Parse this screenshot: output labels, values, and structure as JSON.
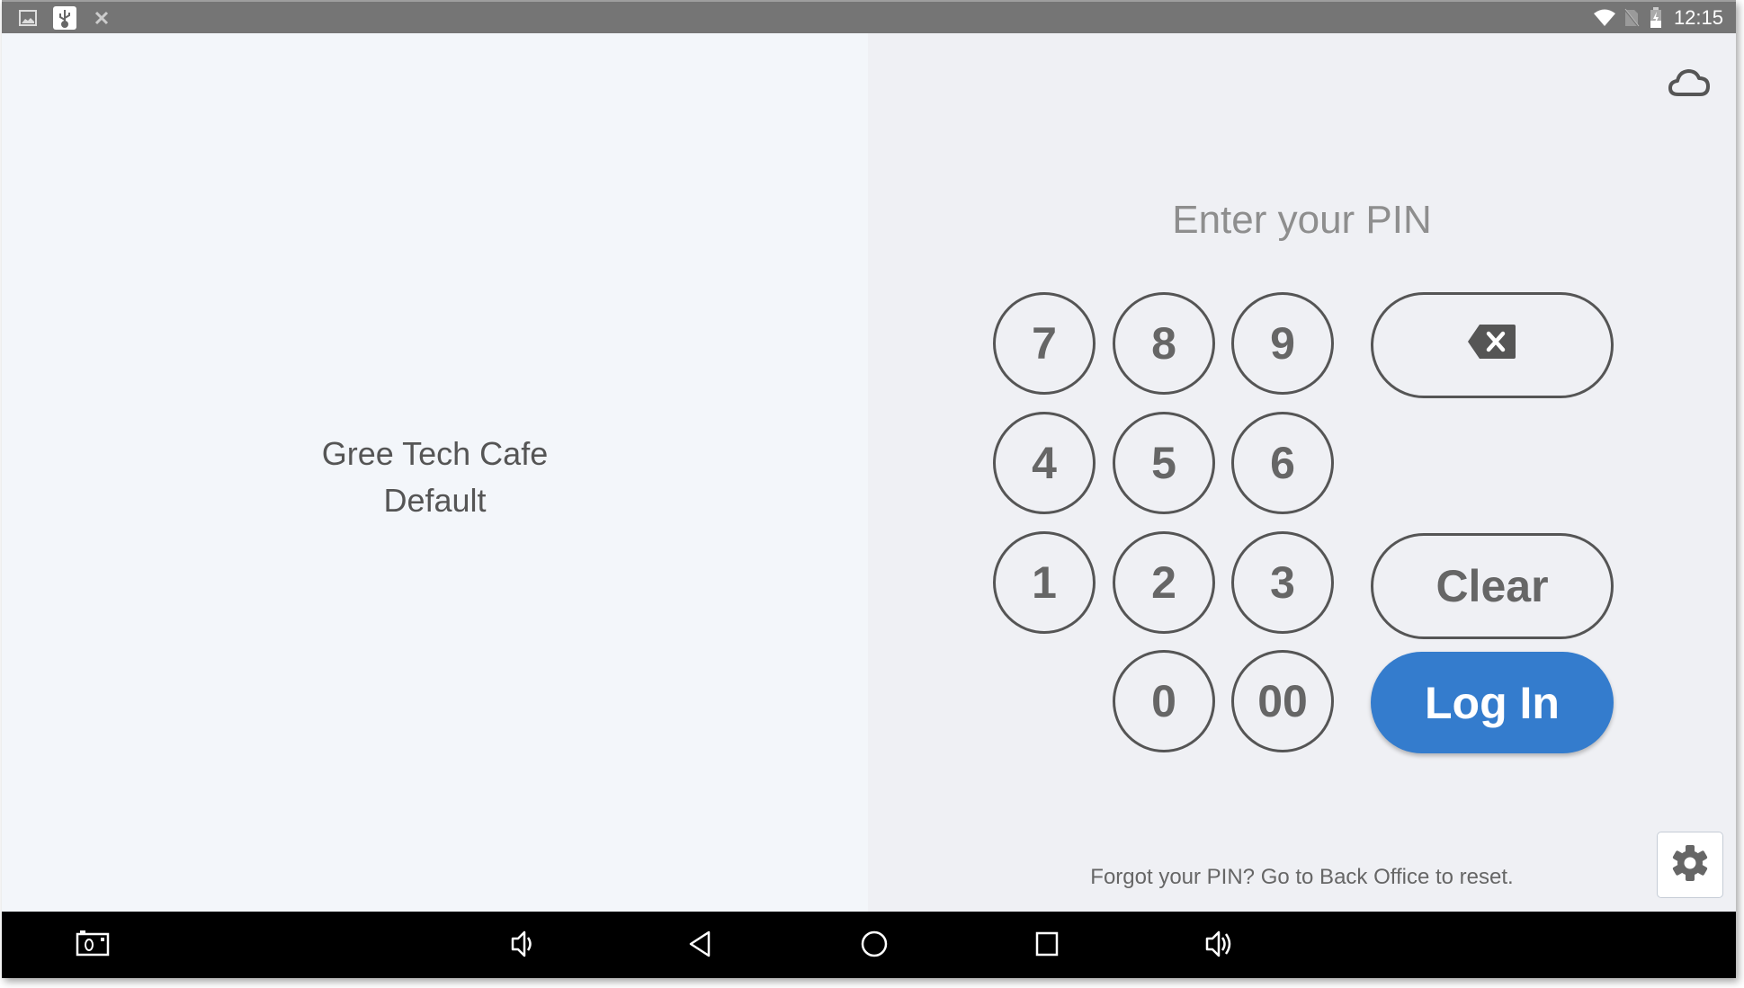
{
  "status_bar": {
    "time": "12:15",
    "left_icons": [
      "image-icon",
      "usb-icon",
      "no-sim-x-icon"
    ],
    "right_icons": [
      "wifi-icon",
      "no-sim-icon",
      "battery-charging-icon"
    ]
  },
  "left_panel": {
    "store_name": "Gree Tech Cafe",
    "profile": "Default"
  },
  "right_panel": {
    "title": "Enter your PIN",
    "keypad": {
      "keys": [
        "7",
        "8",
        "9",
        "4",
        "5",
        "6",
        "1",
        "2",
        "3",
        "0",
        "00"
      ],
      "backspace_icon": "backspace-icon",
      "clear_label": "Clear",
      "login_label": "Log In"
    },
    "forgot_text": "Forgot your PIN? Go to Back Office to reset.",
    "sync_icon": "cloud-icon",
    "settings_icon": "gear-icon"
  },
  "colors": {
    "accent": "#347ccd",
    "status_bar": "#757575",
    "left_bg": "#f3f6fa",
    "right_bg": "#eff0f4"
  },
  "nav_bar": {
    "icons": [
      "screenshot-icon",
      "volume-down-icon",
      "back-icon",
      "home-icon",
      "recents-icon",
      "volume-up-icon"
    ]
  }
}
